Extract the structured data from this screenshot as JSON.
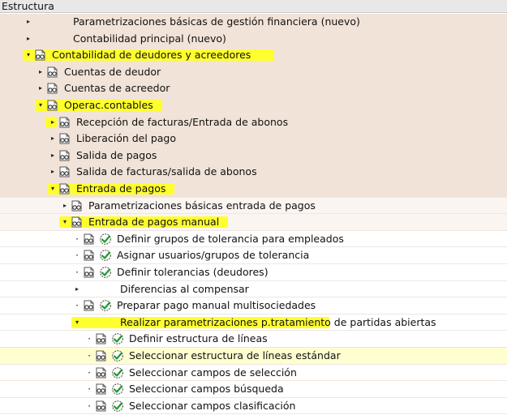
{
  "header": {
    "title": "Estructura"
  },
  "rows": [
    {
      "indent": 0,
      "expander": "collapsed",
      "icons": [],
      "label": "Parametrizaciones básicas de gestión financiera (nuevo)",
      "band": "band",
      "hl": false
    },
    {
      "indent": 0,
      "expander": "collapsed",
      "icons": [],
      "label": "Contabilidad principal (nuevo)",
      "band": "band",
      "hl": false
    },
    {
      "indent": 0,
      "expander": "expanded",
      "icons": [
        "folder"
      ],
      "label": "Contabilidad de deudores y acreedores",
      "band": "band",
      "hl": true
    },
    {
      "indent": 1,
      "expander": "collapsed",
      "icons": [
        "folder"
      ],
      "label": "Cuentas de deudor",
      "band": "band",
      "hl": false
    },
    {
      "indent": 1,
      "expander": "collapsed",
      "icons": [
        "folder"
      ],
      "label": "Cuentas de acreedor",
      "band": "band",
      "hl": false
    },
    {
      "indent": 1,
      "expander": "expanded",
      "icons": [
        "folder"
      ],
      "label": "Operac.contables",
      "band": "band",
      "hl": true
    },
    {
      "indent": 2,
      "expander": "collapsed",
      "icons": [
        "folder"
      ],
      "label": "Recepción de facturas/Entrada de abonos",
      "band": "band",
      "hl": false,
      "hlExp": true
    },
    {
      "indent": 2,
      "expander": "collapsed",
      "icons": [
        "folder"
      ],
      "label": "Liberación del pago",
      "band": "band",
      "hl": false
    },
    {
      "indent": 2,
      "expander": "collapsed",
      "icons": [
        "folder"
      ],
      "label": "Salida de pagos",
      "band": "band",
      "hl": false
    },
    {
      "indent": 2,
      "expander": "collapsed",
      "icons": [
        "folder"
      ],
      "label": "Salida de facturas/salida de abonos",
      "band": "band",
      "hl": false
    },
    {
      "indent": 2,
      "expander": "expanded",
      "icons": [
        "folder"
      ],
      "label": "Entrada de pagos",
      "band": "band",
      "hl": true
    },
    {
      "indent": 3,
      "expander": "collapsed",
      "icons": [
        "folder"
      ],
      "label": "Parametrizaciones básicas entrada de pagos",
      "band": "band2",
      "hl": false
    },
    {
      "indent": 3,
      "expander": "expanded",
      "icons": [
        "folder"
      ],
      "label": "Entrada de pagos manual",
      "band": "band2",
      "hl": true
    },
    {
      "indent": 4,
      "expander": "leaf",
      "icons": [
        "folder",
        "check"
      ],
      "label": "Definir grupos de tolerancia para empleados",
      "band": "",
      "hl": false
    },
    {
      "indent": 4,
      "expander": "leaf",
      "icons": [
        "folder",
        "check"
      ],
      "label": "Asignar usuarios/grupos de tolerancia",
      "band": "",
      "hl": false
    },
    {
      "indent": 4,
      "expander": "leaf",
      "icons": [
        "folder",
        "check"
      ],
      "label": "Definir tolerancias (deudores)",
      "band": "",
      "hl": false
    },
    {
      "indent": 4,
      "expander": "collapsed",
      "icons": [],
      "label": "Diferencias al compensar",
      "band": "",
      "hl": false
    },
    {
      "indent": 4,
      "expander": "leaf",
      "icons": [
        "folder",
        "check"
      ],
      "label": "Preparar pago manual multisociedades",
      "band": "",
      "hl": false
    },
    {
      "indent": 4,
      "expander": "expanded",
      "icons": [],
      "label": "Realizar parametrizaciones p.tratamiento de partidas abiertas",
      "band": "",
      "hl": true
    },
    {
      "indent": 5,
      "expander": "leaf",
      "icons": [
        "folder",
        "check"
      ],
      "label": "Definir estructura de líneas",
      "band": "",
      "hl": false
    },
    {
      "indent": 5,
      "expander": "leaf",
      "icons": [
        "folder",
        "check"
      ],
      "label": "Seleccionar estructura de líneas estándar",
      "band": "sel",
      "hl": false
    },
    {
      "indent": 5,
      "expander": "leaf",
      "icons": [
        "folder",
        "check"
      ],
      "label": "Seleccionar campos de selección",
      "band": "",
      "hl": false
    },
    {
      "indent": 5,
      "expander": "leaf",
      "icons": [
        "folder",
        "check"
      ],
      "label": "Seleccionar campos búsqueda",
      "band": "",
      "hl": false
    },
    {
      "indent": 5,
      "expander": "leaf",
      "icons": [
        "folder",
        "check"
      ],
      "label": "Seleccionar campos clasificación",
      "band": "",
      "hl": false
    }
  ]
}
